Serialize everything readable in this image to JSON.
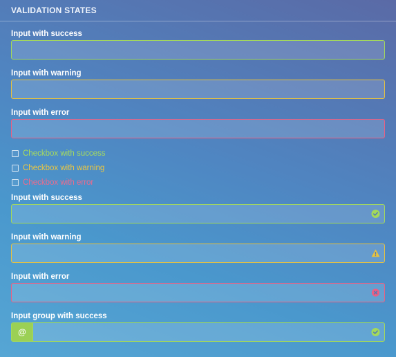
{
  "header": {
    "title": "VALIDATION STATES"
  },
  "inputs_top": [
    {
      "label": "Input with success",
      "value": "",
      "state": "success"
    },
    {
      "label": "Input with warning",
      "value": "",
      "state": "warning"
    },
    {
      "label": "Input with error",
      "value": "",
      "state": "error"
    }
  ],
  "checkboxes": [
    {
      "label": "Checkbox with success",
      "checked": false
    },
    {
      "label": "Checkbox with warning",
      "checked": false
    },
    {
      "label": "Checkbox with error",
      "checked": false
    }
  ],
  "inputs_icon": [
    {
      "label": "Input with success",
      "value": "",
      "icon": "check-circle-icon"
    },
    {
      "label": "Input with warning",
      "value": "",
      "icon": "warning-triangle-icon"
    },
    {
      "label": "Input with error",
      "value": "",
      "icon": "error-circle-x-icon"
    }
  ],
  "input_group": {
    "label": "Input group with success",
    "addon": "@",
    "value": "",
    "icon": "check-circle-icon"
  },
  "colors": {
    "success": "#a4d95a",
    "warning": "#e7c23f",
    "error": "#ec5f82"
  }
}
